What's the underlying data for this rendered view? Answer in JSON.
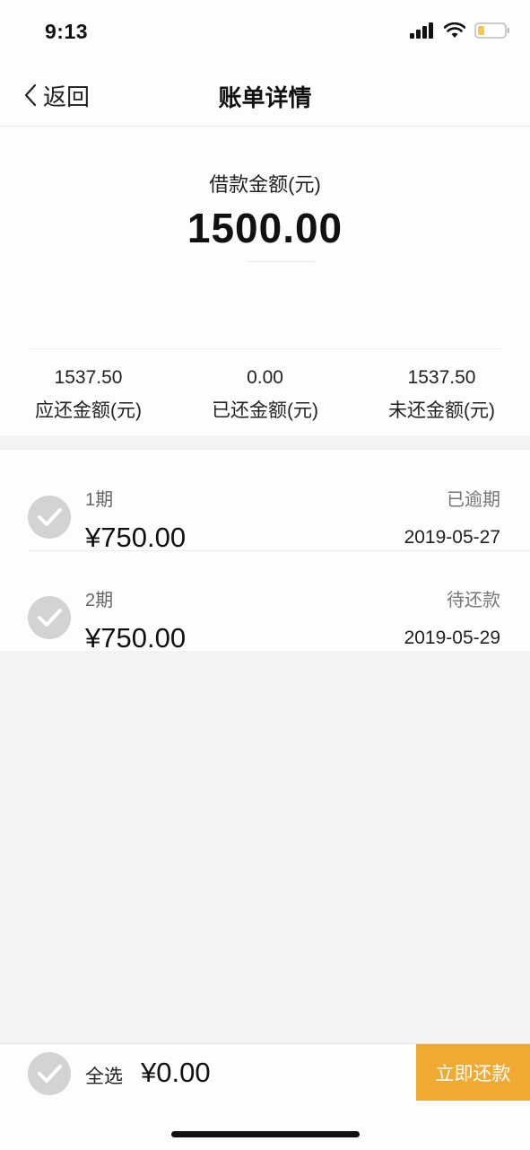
{
  "status_bar": {
    "time": "9:13"
  },
  "nav": {
    "back_label": "返回",
    "title": "账单详情"
  },
  "summary": {
    "loan_label": "借款金额(元)",
    "loan_amount": "1500.00",
    "stats": [
      {
        "value": "1537.50",
        "label": "应还金额(元)"
      },
      {
        "value": "0.00",
        "label": "已还金额(元)"
      },
      {
        "value": "1537.50",
        "label": "未还金额(元)"
      }
    ]
  },
  "installments": [
    {
      "period": "1期",
      "amount": "¥750.00",
      "status": "已逾期",
      "date": "2019-05-27"
    },
    {
      "period": "2期",
      "amount": "¥750.00",
      "status": "待还款",
      "date": "2019-05-29"
    }
  ],
  "footer": {
    "select_all": "全选",
    "total": "¥0.00",
    "pay_button": "立即还款"
  },
  "colors": {
    "accent": "#f0aa31",
    "check": "#d3d3d3",
    "background": "#f3f3f3"
  }
}
